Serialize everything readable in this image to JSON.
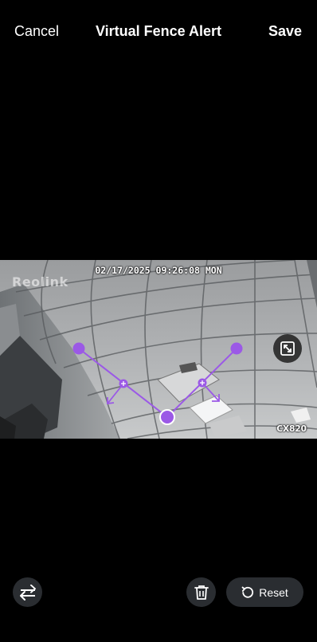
{
  "header": {
    "cancel_label": "Cancel",
    "title": "Virtual Fence Alert",
    "save_label": "Save"
  },
  "video": {
    "timestamp": "02/17/2025 09:26:08 MON",
    "watermark": "Reolink",
    "model": "CX820",
    "fence_color": "#9b59e6"
  },
  "controls": {
    "swap_icon": "swap-arrows-icon",
    "delete_icon": "trash-icon",
    "reset_icon": "reset-rotate-icon",
    "reset_label": "Reset",
    "fullscreen_icon": "fullscreen-icon"
  },
  "colors": {
    "background": "#000000",
    "button_bg": "#2a2d31",
    "accent": "#9b59e6"
  }
}
